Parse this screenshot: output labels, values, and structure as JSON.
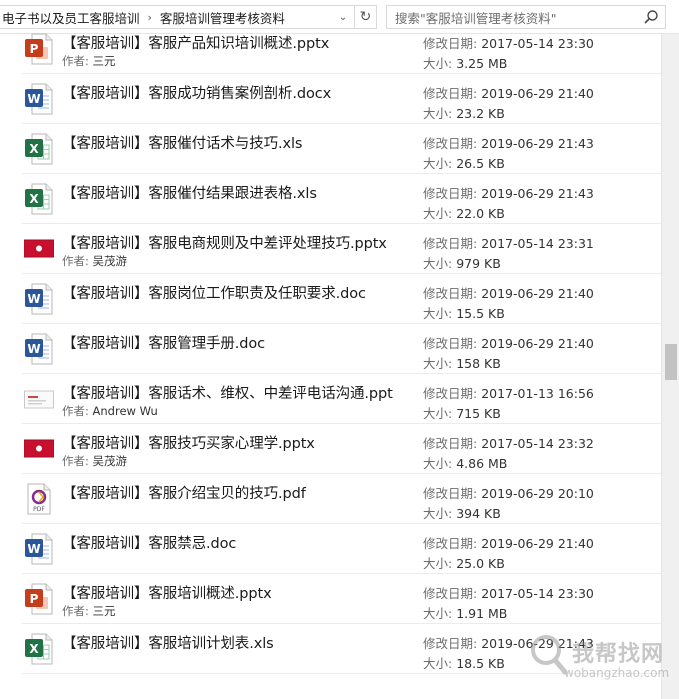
{
  "address_bar": {
    "segments": [
      "电子书以及员工客服培训",
      "客服培训管理考核资料"
    ],
    "search_placeholder": "搜索\"客服培训管理考核资料\""
  },
  "labels": {
    "modified": "修改日期:",
    "size": "大小:",
    "author": "作者:"
  },
  "files": [
    {
      "name": "【客服培训】客服产品知识培训概述.pptx",
      "type": "pptx",
      "author": "三元",
      "modified": "2017-05-14 23:30",
      "size": "3.25 MB"
    },
    {
      "name": "【客服培训】客服成功销售案例剖析.docx",
      "type": "docx",
      "author": "",
      "modified": "2019-06-29 21:40",
      "size": "23.2 KB"
    },
    {
      "name": "【客服培训】客服催付话术与技巧.xls",
      "type": "xls",
      "author": "",
      "modified": "2019-06-29 21:43",
      "size": "26.5 KB"
    },
    {
      "name": "【客服培训】客服催付结果跟进表格.xls",
      "type": "xls",
      "author": "",
      "modified": "2019-06-29 21:43",
      "size": "22.0 KB"
    },
    {
      "name": "【客服培训】客服电商规则及中差评处理技巧.pptx",
      "type": "pptx-thumb-red",
      "author": "吴茂游",
      "modified": "2017-05-14 23:31",
      "size": "979 KB"
    },
    {
      "name": "【客服培训】客服岗位工作职责及任职要求.doc",
      "type": "doc",
      "author": "",
      "modified": "2019-06-29 21:40",
      "size": "15.5 KB"
    },
    {
      "name": "【客服培训】客服管理手册.doc",
      "type": "doc",
      "author": "",
      "modified": "2019-06-29 21:40",
      "size": "158 KB"
    },
    {
      "name": "【客服培训】客服话术、维权、中差评电话沟通.ppt",
      "type": "ppt-thumb-white",
      "author": "Andrew Wu",
      "modified": "2017-01-13 16:56",
      "size": "715 KB"
    },
    {
      "name": "【客服培训】客服技巧买家心理学.pptx",
      "type": "pptx-thumb-red",
      "author": "吴茂游",
      "modified": "2017-05-14 23:32",
      "size": "4.86 MB"
    },
    {
      "name": "【客服培训】客服介绍宝贝的技巧.pdf",
      "type": "pdf",
      "author": "",
      "modified": "2019-06-29 20:10",
      "size": "394 KB"
    },
    {
      "name": "【客服培训】客服禁忌.doc",
      "type": "doc",
      "author": "",
      "modified": "2019-06-29 21:40",
      "size": "25.0 KB"
    },
    {
      "name": "【客服培训】客服培训概述.pptx",
      "type": "pptx",
      "author": "三元",
      "modified": "2017-05-14 23:30",
      "size": "1.91 MB"
    },
    {
      "name": "【客服培训】客服培训计划表.xls",
      "type": "xls",
      "author": "",
      "modified": "2019-06-29 21:43",
      "size": "18.5 KB"
    }
  ],
  "icons": {
    "pptx": "powerpoint-icon",
    "docx": "word-icon",
    "doc": "word-icon",
    "xls": "excel-icon",
    "pdf": "pdf-icon",
    "pptx-thumb-red": "slide-thumbnail-icon",
    "ppt-thumb-white": "slide-thumbnail-icon"
  },
  "colors": {
    "powerpoint": "#c43e1c",
    "word": "#2b579a",
    "excel": "#217346",
    "pdf": "#8a2d8a",
    "thumb_red": "#c8102e"
  },
  "watermark": {
    "text": "我帮找网",
    "url": "wobangzhao.com"
  }
}
